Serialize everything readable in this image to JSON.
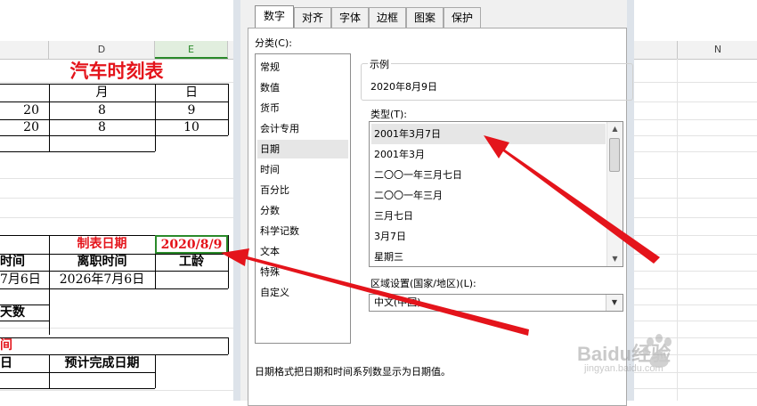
{
  "spreadsheet": {
    "columns": [
      {
        "id": "c",
        "label": ""
      },
      {
        "id": "d",
        "label": "D"
      },
      {
        "id": "e",
        "label": "E"
      }
    ],
    "title": "汽车时刻表",
    "header_row": {
      "c": "",
      "d": "月",
      "e": "日"
    },
    "rows": [
      {
        "c": "20",
        "d": "8",
        "e": "9"
      },
      {
        "c": "20",
        "d": "8",
        "e": "10"
      }
    ],
    "report_date_label": "制表日期",
    "report_date_value": "2020/8/9",
    "time_label": "时间",
    "departure_label": "离职时间",
    "seniority_label": "工龄",
    "hire_date_value": "7月6日",
    "departure_date_value": "2026年7月6日",
    "days_label": "天数",
    "red_time_label": "间",
    "day_label": "日",
    "planned_completion_label": "预计完成日期"
  },
  "right_sheet": {
    "column_label": "N"
  },
  "dialog": {
    "tabs": [
      {
        "label": "数字",
        "active": true
      },
      {
        "label": "对齐",
        "active": false
      },
      {
        "label": "字体",
        "active": false
      },
      {
        "label": "边框",
        "active": false
      },
      {
        "label": "图案",
        "active": false
      },
      {
        "label": "保护",
        "active": false
      }
    ],
    "category_label": "分类(C):",
    "categories": [
      "常规",
      "数值",
      "货币",
      "会计专用",
      "日期",
      "时间",
      "百分比",
      "分数",
      "科学记数",
      "文本",
      "特殊",
      "自定义"
    ],
    "selected_category": "日期",
    "sample_label": "示例",
    "sample_value": "2020年8月9日",
    "type_label": "类型(T):",
    "types": [
      "2001年3月7日",
      "2001年3月",
      "二〇〇一年三月七日",
      "二〇〇一年三月",
      "三月七日",
      "3月7日",
      "星期三"
    ],
    "selected_type": "2001年3月7日",
    "locale_label": "区域设置(国家/地区)(L):",
    "locale_value": "中文(中国)",
    "description": "日期格式把日期和时间系列数显示为日期值。"
  },
  "watermark": {
    "brand": "Baidu经验",
    "url": "jingyan.baidu.com"
  },
  "colors": {
    "red": "#e4141b",
    "green_selection": "#2a8a2a"
  }
}
